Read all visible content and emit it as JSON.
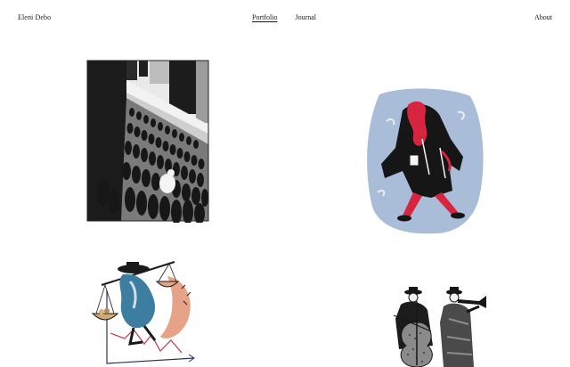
{
  "header": {
    "brand": "Eleni Debo",
    "nav": [
      {
        "label": "Portfolio",
        "active": true
      },
      {
        "label": "Journal",
        "active": false
      }
    ],
    "about": "About"
  },
  "colors": {
    "text": "#1a1a1a",
    "background": "#ffffff",
    "ink": "#161616",
    "accent_red": "#d8253f",
    "pale_blue": "#9fb5d2",
    "teal_blue": "#3d7ea0",
    "salmon": "#e6a388"
  },
  "portfolio": {
    "items": [
      {
        "subject": "crowd-street-illustration"
      },
      {
        "subject": "coat-figure-illustration"
      },
      {
        "subject": "scales-figure-illustration"
      },
      {
        "subject": "musicians-illustration"
      }
    ]
  }
}
